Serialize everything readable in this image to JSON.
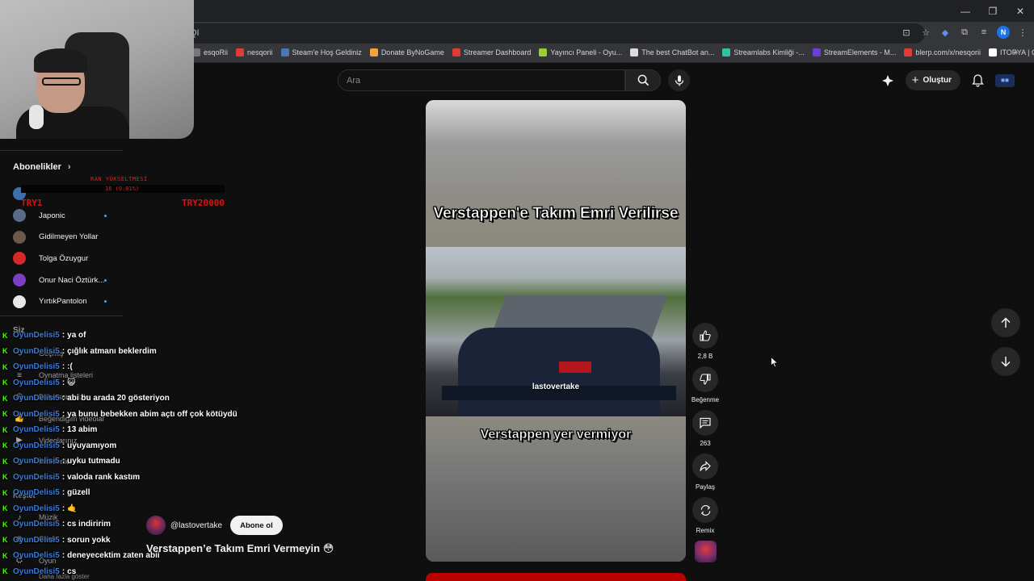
{
  "browser": {
    "omnibox_text": "QI",
    "bookmarks": [
      {
        "label": "esqoRii",
        "color": "#777"
      },
      {
        "label": "nesqorii",
        "color": "#e53935"
      },
      {
        "label": "Steam'e Hoş Geldiniz",
        "color": "#4a77b4"
      },
      {
        "label": "Donate ByNoGame",
        "color": "#f2a33a"
      },
      {
        "label": "Streamer Dashboard",
        "color": "#e53935"
      },
      {
        "label": "Yayıncı Paneli - Oyu...",
        "color": "#9acd32"
      },
      {
        "label": "The best ChatBot an...",
        "color": "#dddddd"
      },
      {
        "label": "Streamlabs Kimliği -...",
        "color": "#31c3a2"
      },
      {
        "label": "StreamElements - M...",
        "color": "#6a3fd6"
      },
      {
        "label": "blerp.com/x/nesqorii",
        "color": "#e53935"
      },
      {
        "label": "ITOPYA | Gaming Ür...",
        "color": "#ffffff"
      }
    ],
    "more_bookmarks": "»",
    "profile_initial": "N"
  },
  "youtube": {
    "search_placeholder": "Ara",
    "create_label": "Oluştur"
  },
  "sidebar": {
    "subscriptions_header": "Abonelikler",
    "subscriptions": [
      {
        "name": "",
        "color": "#3a6fb0",
        "dot": false
      },
      {
        "name": "Japonic",
        "color": "#5a6b8a",
        "dot": true
      },
      {
        "name": "Gidilmeyen Yollar",
        "color": "#6b5a4a",
        "dot": false
      },
      {
        "name": "Tolga Özuygur",
        "color": "#d62828",
        "dot": false
      },
      {
        "name": "Onur Naci Öztürk...",
        "color": "#7b3fc4",
        "dot": true
      },
      {
        "name": "YırtıkPantolon",
        "color": "#e8e8e8",
        "dot": true
      }
    ],
    "you_header": "Siz",
    "you_items": [
      {
        "icon": "history-icon",
        "glyph": "⟲",
        "label": "Geçmiş"
      },
      {
        "icon": "playlist-icon",
        "glyph": "≡",
        "label": "Oynatma listeleri"
      },
      {
        "icon": "watch-later-icon",
        "glyph": "◷",
        "label": "Daha sonra izle"
      },
      {
        "icon": "like-icon",
        "glyph": "👍",
        "label": "Beğendiğim videolar"
      },
      {
        "icon": "your-videos-icon",
        "glyph": "▶",
        "label": "Videolarınız"
      },
      {
        "icon": "downloads-icon",
        "glyph": "⤓",
        "label": "İndirilenler"
      }
    ],
    "explore_header": "Keşfet",
    "explore_items": [
      {
        "icon": "music-icon",
        "glyph": "♪",
        "label": "Müzik"
      },
      {
        "icon": "live-icon",
        "glyph": "◉",
        "label": "Canlı"
      },
      {
        "icon": "gaming-icon",
        "glyph": "⛭",
        "label": "Oyun"
      }
    ],
    "more_label": "Daha fazla göster"
  },
  "rank_overlay": {
    "title": "RAN YÜKSELTMESİ",
    "percent": "16 (0.01%)",
    "min": "TRY1",
    "max": "TRY20000"
  },
  "chat": [
    {
      "user": "OyunDelisi5",
      "msg": "ya of"
    },
    {
      "user": "OyunDelisi5",
      "msg": "çığlık atmanı beklerdim"
    },
    {
      "user": "OyunDelisi5",
      "msg": ":("
    },
    {
      "user": "OyunDelisi5",
      "msg": "😺"
    },
    {
      "user": "OyunDelisi5",
      "msg": "abi bu arada 20 gösteriyon"
    },
    {
      "user": "OyunDelisi5",
      "msg": "ya bunu bebekken abim açtı off çok kötüydü"
    },
    {
      "user": "OyunDelisi5",
      "msg": "13 abim"
    },
    {
      "user": "OyunDelisi5",
      "msg": "uyuyamıyom"
    },
    {
      "user": "OyunDelisi5",
      "msg": "uyku tutmadu"
    },
    {
      "user": "OyunDelisi5",
      "msg": "valoda rank kastım"
    },
    {
      "user": "OyunDelisi5",
      "msg": "güzell"
    },
    {
      "user": "OyunDelisi5",
      "msg": "🤙"
    },
    {
      "user": "OyunDelisi5",
      "msg": "cs indiririm"
    },
    {
      "user": "OyunDelisi5",
      "msg": "sorun yokk"
    },
    {
      "user": "OyunDelisi5",
      "msg": "deneyecektim zaten abii"
    },
    {
      "user": "OyunDelisi5",
      "msg": "cs"
    }
  ],
  "short": {
    "overlay_top": "Verstappen'e Takım Emri Verilirse",
    "overlay_bottom": "Verstappen yer vermiyor",
    "watermark": "lastovertake",
    "channel": "@lastovertake",
    "subscribe_label": "Abone ol",
    "caption": "Verstappen’e Takım Emri Vermeyin 😳"
  },
  "actions": {
    "likes": "2,8 B",
    "dislike_label": "Beğenme",
    "comments": "263",
    "share_label": "Paylaş",
    "remix_label": "Remix"
  }
}
